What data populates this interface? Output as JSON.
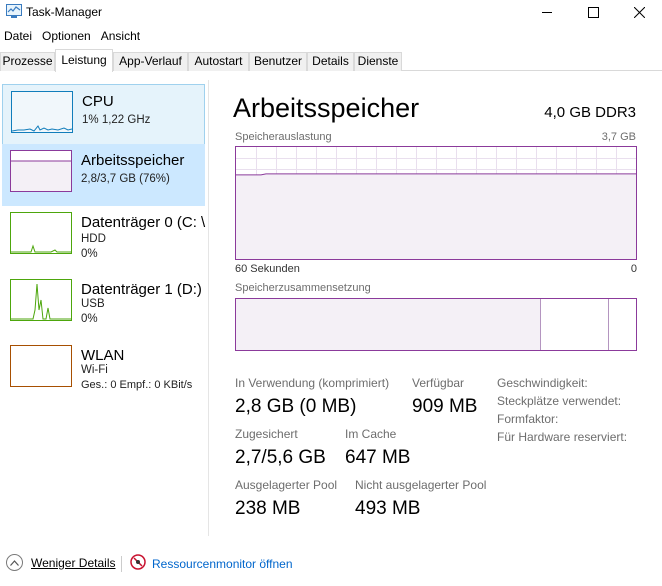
{
  "window": {
    "title": "Task-Manager"
  },
  "menu": [
    "Datei",
    "Optionen",
    "Ansicht"
  ],
  "tabs": [
    "Prozesse",
    "Leistung",
    "App-Verlauf",
    "Autostart",
    "Benutzer",
    "Details",
    "Dienste"
  ],
  "active_tab": "Leistung",
  "sidebar": {
    "items": [
      {
        "title": "CPU",
        "line1": "1%  1,22 GHz",
        "line2": "",
        "color": "#117dbb"
      },
      {
        "title": "Arbeitsspeicher",
        "line1": "2,8/3,7 GB (76%)",
        "line2": "",
        "color": "#8b3a9b"
      },
      {
        "title": "Datenträger 0 (C: \\",
        "line1": "HDD",
        "line2": "0%",
        "color": "#4da60c"
      },
      {
        "title": "Datenträger 1 (D:)",
        "line1": "USB",
        "line2": "0%",
        "color": "#4da60c"
      },
      {
        "title": "WLAN",
        "line1": "Wi-Fi",
        "line2": "Ges.: 0  Empf.: 0 KBit/s",
        "color": "#a74f01"
      }
    ]
  },
  "main": {
    "title": "Arbeitsspeicher",
    "spec": "4,0 GB DDR3",
    "usage_label": "Speicherauslastung",
    "usage_max": "3,7 GB",
    "time_left": "60 Sekunden",
    "time_right": "0",
    "composition_label": "Speicherzusammensetzung",
    "usage_level": 0.76,
    "stats": {
      "in_use_label": "In Verwendung (komprimiert)",
      "in_use_value": "2,8 GB (0 MB)",
      "available_label": "Verfügbar",
      "available_value": "909 MB",
      "committed_label": "Zugesichert",
      "committed_value": "2,7/5,6 GB",
      "cached_label": "Im Cache",
      "cached_value": "647 MB",
      "paged_label": "Ausgelagerter Pool",
      "paged_value": "238 MB",
      "nonpaged_label": "Nicht ausgelagerter Pool",
      "nonpaged_value": "493 MB"
    },
    "properties": {
      "speed": "Geschwindigkeit:",
      "slots": "Steckplätze verwendet:",
      "form": "Formfaktor:",
      "reserved": "Für Hardware reserviert:"
    }
  },
  "footer": {
    "fewer_details": "Weniger Details",
    "resource_monitor": "Ressourcenmonitor öffnen"
  },
  "colors": {
    "memory": "#8b3a9b",
    "cpu": "#117dbb",
    "disk": "#4da60c",
    "wlan": "#a74f01",
    "selection": "#cce8ff"
  }
}
